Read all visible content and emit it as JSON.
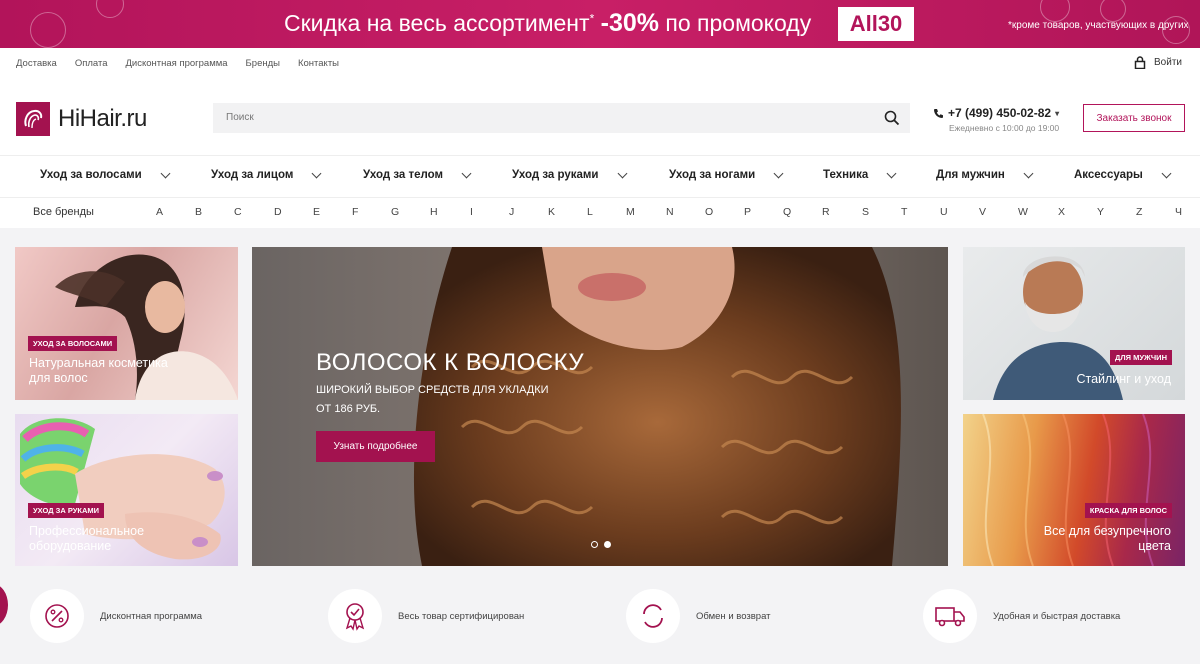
{
  "promo": {
    "text_prefix": "Скидка на весь ассортимент",
    "asterisk": "*",
    "discount": "-30%",
    "text_mid": "по промокоду",
    "code": "All30",
    "note": "*кроме товаров, участвующих в других"
  },
  "toplinks": [
    "Доставка",
    "Оплата",
    "Дисконтная программа",
    "Бренды",
    "Контакты"
  ],
  "login_label": "Войти",
  "logo_text": "HiHair.ru",
  "search": {
    "placeholder": "Поиск"
  },
  "contact": {
    "phone": "+7 (499) 450-02-82",
    "hours": "Ежедневно с 10:00 до 19:00",
    "callback_label": "Заказать звонок"
  },
  "nav": [
    "Уход за волосами",
    "Уход за лицом",
    "Уход за телом",
    "Уход за руками",
    "Уход за ногами",
    "Техника",
    "Для мужчин",
    "Аксессуары"
  ],
  "brands": {
    "all_label": "Все бренды",
    "letters": [
      "A",
      "B",
      "C",
      "D",
      "E",
      "F",
      "G",
      "H",
      "I",
      "J",
      "K",
      "L",
      "M",
      "N",
      "O",
      "P",
      "Q",
      "R",
      "S",
      "T",
      "U",
      "V",
      "W",
      "X",
      "Y",
      "Z",
      "Ч"
    ]
  },
  "tiles": {
    "hair": {
      "tag": "Уход за волосами",
      "title": "Натуральная косметика для волос"
    },
    "hands": {
      "tag": "Уход за руками",
      "title": "Профессиональное оборудование"
    },
    "men": {
      "tag": "Для мужчин",
      "title": "Стайлинг и уход"
    },
    "dye": {
      "tag": "Краска для волос",
      "title": "Все для безупречного цвета"
    }
  },
  "hero": {
    "title": "ВОЛОСОК К ВОЛОСКУ",
    "subtitle": "ШИРОКИЙ ВЫБОР СРЕДСТВ ДЛЯ УКЛАДКИ ОТ 186 РУБ.",
    "button": "Узнать подробнее"
  },
  "features": [
    "Дисконтная программа",
    "Весь товар сертифицирован",
    "Обмен и возврат",
    "Удобная и быстрая доставка"
  ],
  "colors": {
    "brand": "#a3124f",
    "promo": "#c81f66"
  },
  "icons": [
    "search-icon",
    "lock-icon",
    "phone-icon",
    "percent-icon",
    "certificate-icon",
    "exchange-icon",
    "truck-icon"
  ]
}
